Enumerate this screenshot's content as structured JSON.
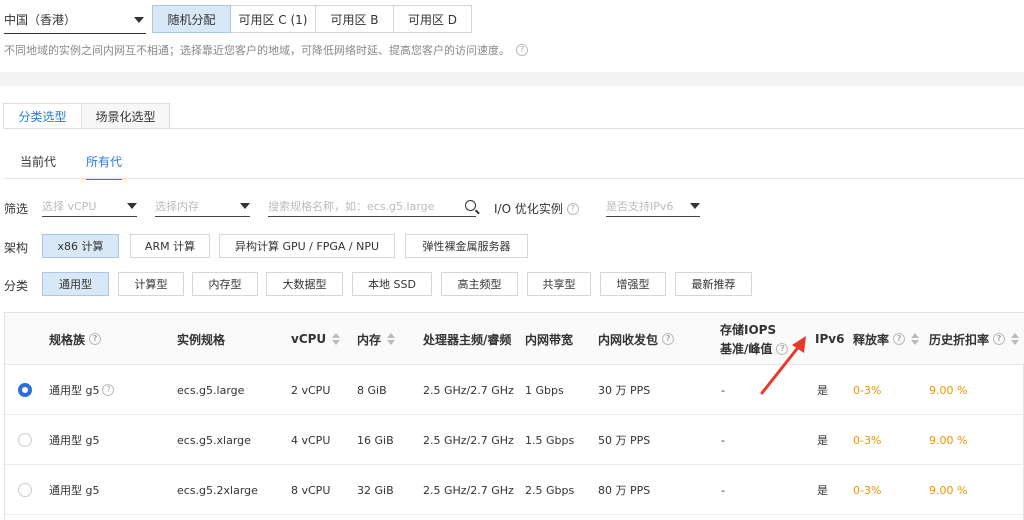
{
  "region": {
    "selected": "中国（香港）",
    "note": "不同地域的实例之间内网互不相通；选择靠近您客户的地域，可降低网络时延、提高您客户的访问速度。"
  },
  "zones": [
    "随机分配",
    "可用区 C (1)",
    "可用区 B",
    "可用区 D"
  ],
  "tabs": [
    "分类选型",
    "场景化选型"
  ],
  "subtabs": [
    "当前代",
    "所有代"
  ],
  "filter": {
    "label": "筛选",
    "vcpu_placeholder": "选择 vCPU",
    "memory_placeholder": "选择内存",
    "search_placeholder": "搜索规格名称，如：ecs.g5.large",
    "io_label": "I/O 优化实例",
    "ipv6_placeholder": "是否支持IPv6"
  },
  "arch": {
    "label": "架构",
    "options": [
      "x86 计算",
      "ARM 计算",
      "异构计算 GPU / FPGA / NPU",
      "弹性裸金属服务器"
    ]
  },
  "category": {
    "label": "分类",
    "options": [
      "通用型",
      "计算型",
      "内存型",
      "大数据型",
      "本地 SSD",
      "高主频型",
      "共享型",
      "增强型",
      "最新推荐"
    ]
  },
  "table": {
    "headers": {
      "family": "规格族",
      "spec": "实例规格",
      "vcpu": "vCPU",
      "memory": "内存",
      "cpu_freq": "处理器主频/睿频",
      "bandwidth": "内网带宽",
      "pps": "内网收发包",
      "iops_1": "存储IOPS",
      "iops_2": "基准/峰值",
      "ipv6": "IPv6",
      "release": "释放率",
      "discount": "历史折扣率"
    },
    "rows": [
      {
        "family": "通用型 g5",
        "spec": "ecs.g5.large",
        "vcpu": "2 vCPU",
        "memory": "8 GiB",
        "cpu_freq": "2.5 GHz/2.7 GHz",
        "bandwidth": "1 Gbps",
        "pps": "30 万 PPS",
        "iops": "-",
        "ipv6": "是",
        "release": "0-3%",
        "discount": "9.00 %"
      },
      {
        "family": "通用型 g5",
        "spec": "ecs.g5.xlarge",
        "vcpu": "4 vCPU",
        "memory": "16 GiB",
        "cpu_freq": "2.5 GHz/2.7 GHz",
        "bandwidth": "1.5 Gbps",
        "pps": "50 万 PPS",
        "iops": "-",
        "ipv6": "是",
        "release": "0-3%",
        "discount": "9.00 %"
      },
      {
        "family": "通用型 g5",
        "spec": "ecs.g5.2xlarge",
        "vcpu": "8 vCPU",
        "memory": "32 GiB",
        "cpu_freq": "2.5 GHz/2.7 GHz",
        "bandwidth": "2.5 Gbps",
        "pps": "80 万 PPS",
        "iops": "-",
        "ipv6": "是",
        "release": "0-3%",
        "discount": "9.00 %"
      }
    ]
  },
  "colors": {
    "accent": "#2a7ae2",
    "active_bg": "#d9e8f6",
    "orange": "#f39200",
    "arrow": "#e8392c"
  }
}
